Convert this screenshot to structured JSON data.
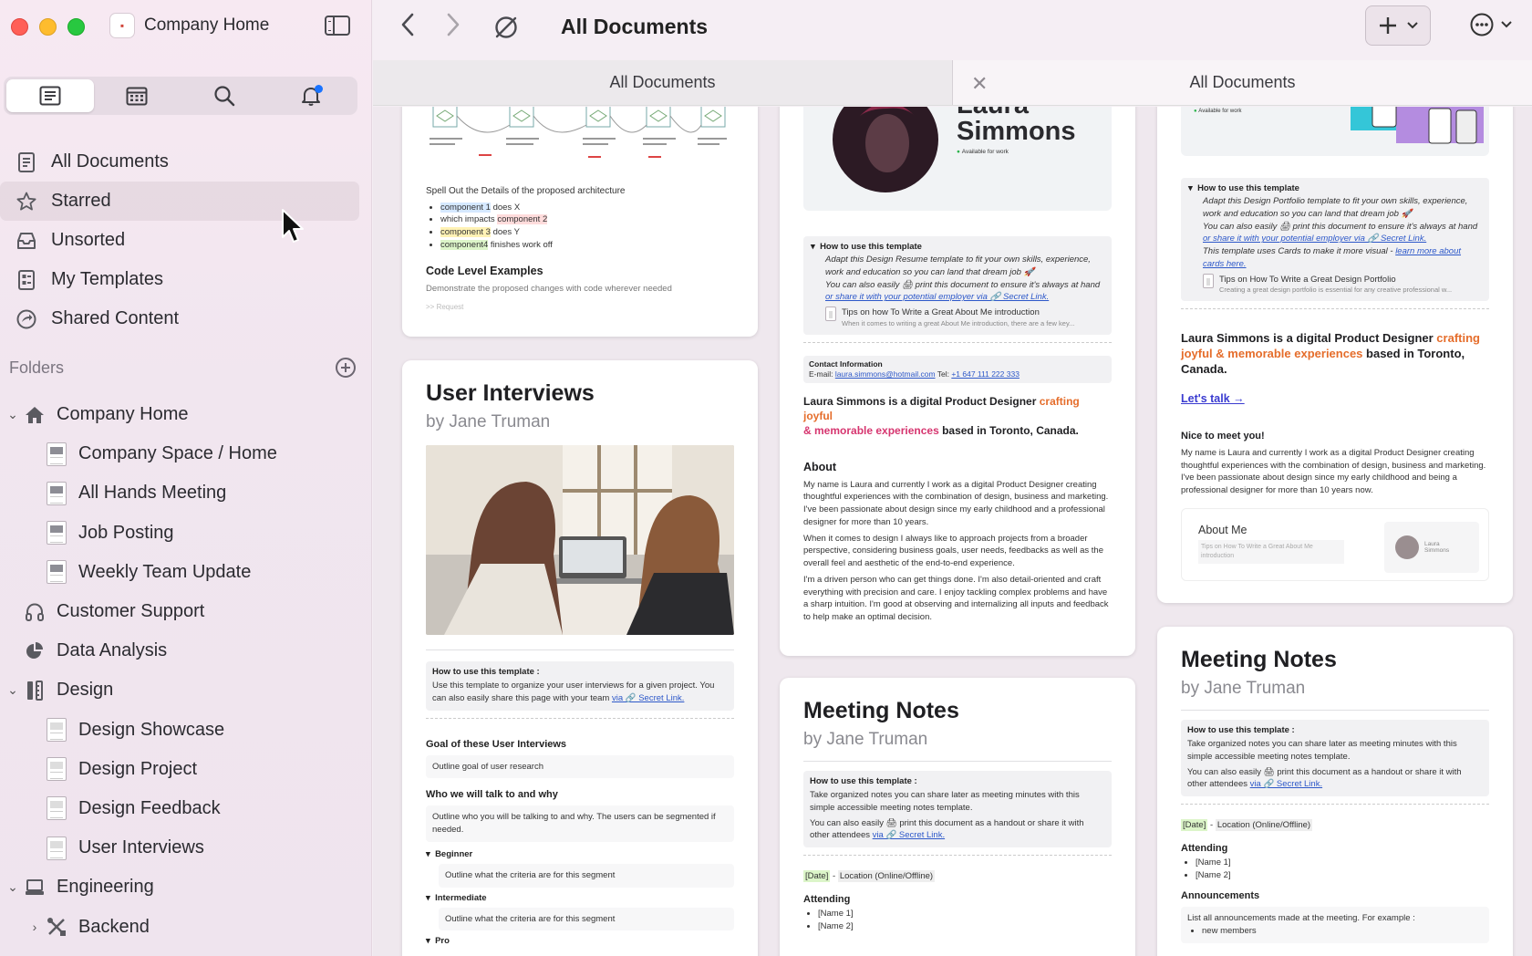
{
  "window": {
    "workspace": "Company Home"
  },
  "toolbar": {
    "title": "All Documents"
  },
  "tabs": [
    {
      "label": "All Documents"
    },
    {
      "label": "All Documents"
    }
  ],
  "nav": {
    "all_documents": "All Documents",
    "starred": "Starred",
    "unsorted": "Unsorted",
    "my_templates": "My Templates",
    "shared_content": "Shared Content"
  },
  "folders": {
    "header": "Folders",
    "items": [
      {
        "label": "Company Home"
      },
      {
        "label": "Company Space / Home"
      },
      {
        "label": "All Hands Meeting"
      },
      {
        "label": "Job Posting"
      },
      {
        "label": "Weekly Team Update"
      },
      {
        "label": "Customer Support"
      },
      {
        "label": "Data Analysis"
      },
      {
        "label": "Design"
      },
      {
        "label": "Design Showcase"
      },
      {
        "label": "Design Project"
      },
      {
        "label": "Design Feedback"
      },
      {
        "label": "User Interviews"
      },
      {
        "label": "Engineering"
      },
      {
        "label": "Backend"
      }
    ]
  },
  "cards": {
    "arch": {
      "spell": "Spell Out the Details of the proposed architecture",
      "b1a": "component 1",
      "b1b": " does X",
      "b2a": "which impacts ",
      "b2b": "component 2",
      "b3a": "component 3",
      "b3b": " does Y",
      "b4a": "component4",
      "b4b": " finishes work off",
      "code_title": "Code Level Examples",
      "code_desc": "Demonstrate the proposed changes with code wherever needed",
      "req": ">> Request"
    },
    "ui": {
      "title": "User Interviews",
      "by": "by Jane Truman",
      "how_title": "How to use this template :",
      "how_text": "Use this template to organize your user interviews for a given project. You can also easily share this page with your team ",
      "how_link": "via 🔗 Secret Link.",
      "goal_title": "Goal of these User Interviews",
      "goal_text": "Outline goal of user research",
      "who_title": "Who we will talk to and why",
      "who_text": "Outline who you will be talking to and why. The users can be segmented if needed.",
      "seg1": "Beginner",
      "seg2": "Intermediate",
      "seg3": "Pro",
      "seg_text": "Outline what the criteria are for this segment"
    },
    "resume": {
      "name1": "Laura",
      "name2": "Simmons",
      "avail": "Available for work",
      "how_title": "How to use this template",
      "how_text1": "Adapt this Design Resume template to fit your own skills, experience, work and education so you can land that dream job 🚀",
      "how_text2": "You can also easily 🖨 print this document to ensure it's always at hand",
      "how_link": "or share it with your potential employer via 🔗 Secret Link.",
      "tips_title": "Tips on how To Write a Great About Me introduction",
      "tips_text": "When it comes to writing a great About Me introduction, there are a few key...",
      "contact_title": "Contact Information",
      "contact_email_label": "E-mail: ",
      "contact_email": "laura.simmons@hotmail.com",
      "contact_tel_label": " Tel: ",
      "contact_tel": "+1 647 111 222 333",
      "headline_a": "Laura Simmons is a digital Product Designer ",
      "headline_b": "crafting joyful",
      "headline_c": "& memorable experiences",
      "headline_d": " based in Toronto, Canada.",
      "about_title": "About",
      "about_p1": "My name is Laura and currently I work as a digital Product Designer creating thoughtful experiences with the combination of design, business and marketing. I've been passionate about design since my early childhood and a professional designer for more than 10 years.",
      "about_p2": "When it comes to design I always like to approach projects from a broader perspective, considering business goals, user needs, feedbacks as well as the overall feel and aesthetic of the end-to-end experience.",
      "about_p3": "I'm a driven person who can get things done. I'm also detail-oriented and craft everything with precision and care. I enjoy tackling complex problems and have a sharp intuition. I'm good at observing and internalizing all inputs and feedback to help make an optimal decision."
    },
    "meeting1": {
      "title": "Meeting Notes",
      "by": "by Jane Truman",
      "how_title": "How to use this template :",
      "how_text1": "Take organized notes you can share later as meeting minutes with this simple accessible meeting notes template.",
      "how_text2": "You can also easily 🖨 print this document as a handout or share it with other attendees ",
      "how_link": "via 🔗 Secret Link.",
      "date": "[Date]",
      "location": "Location (Online/Offline)",
      "attending": "Attending",
      "name1": "[Name 1]",
      "name2": "[Name 2]"
    },
    "portfolio": {
      "avail": "Available for work",
      "how_title": "How to use this template",
      "how_text1": "Adapt this Design Portfolio template to fit your own skills, experience, work and education so you can land that dream job 🚀",
      "how_text2": "You can also easily 🖨 print this document to ensure it's always at hand",
      "how_link": "or share it with your potential employer via 🔗 Secret Link.",
      "how_text3": "This template uses Cards to make it more visual - ",
      "how_link2": "learn more about cards here.",
      "tips_title": "Tips on How To Write a Great Design Portfolio",
      "tips_text": "Creating a great design portfolio is essential for any creative professional w...",
      "headline_a": "Laura Simmons is a digital Product Designer ",
      "headline_b": "crafting joyful & memorable experiences",
      "headline_c": " based in Toronto, Canada.",
      "talk": "Let's talk →",
      "nice": "Nice to meet you!",
      "nice_text": "My name is Laura and currently I work as a digital Product Designer creating thoughtful experiences with the combination of design, business and marketing. I've been passionate about design since my early childhood and being a professional designer for more than 10 years now.",
      "about_me": "About Me",
      "mini_tips": "Tips on How To Write a Great About Me introduction",
      "mini_name": "Laura Simmons"
    },
    "meeting2": {
      "title": "Meeting Notes",
      "by": "by Jane Truman",
      "how_title": "How to use this template :",
      "how_text1": "Take organized notes you can share later as meeting minutes with this simple accessible meeting notes template.",
      "how_text2": "You can also easily 🖨 print this document as a handout or share it with other attendees ",
      "how_link": "via 🔗 Secret Link.",
      "date": "[Date]",
      "location": "Location (Online/Offline)",
      "attending": "Attending",
      "name1": "[Name 1]",
      "name2": "[Name 2]",
      "announce": "Announcements",
      "announce_text": "List all announcements made at the meeting. For example :",
      "announce_item": "new members"
    }
  },
  "colors": {
    "accent": "#1a73ff",
    "highlight_orange": "#e56d2b",
    "highlight_pink": "#d6356f",
    "link": "#2d58c9"
  }
}
